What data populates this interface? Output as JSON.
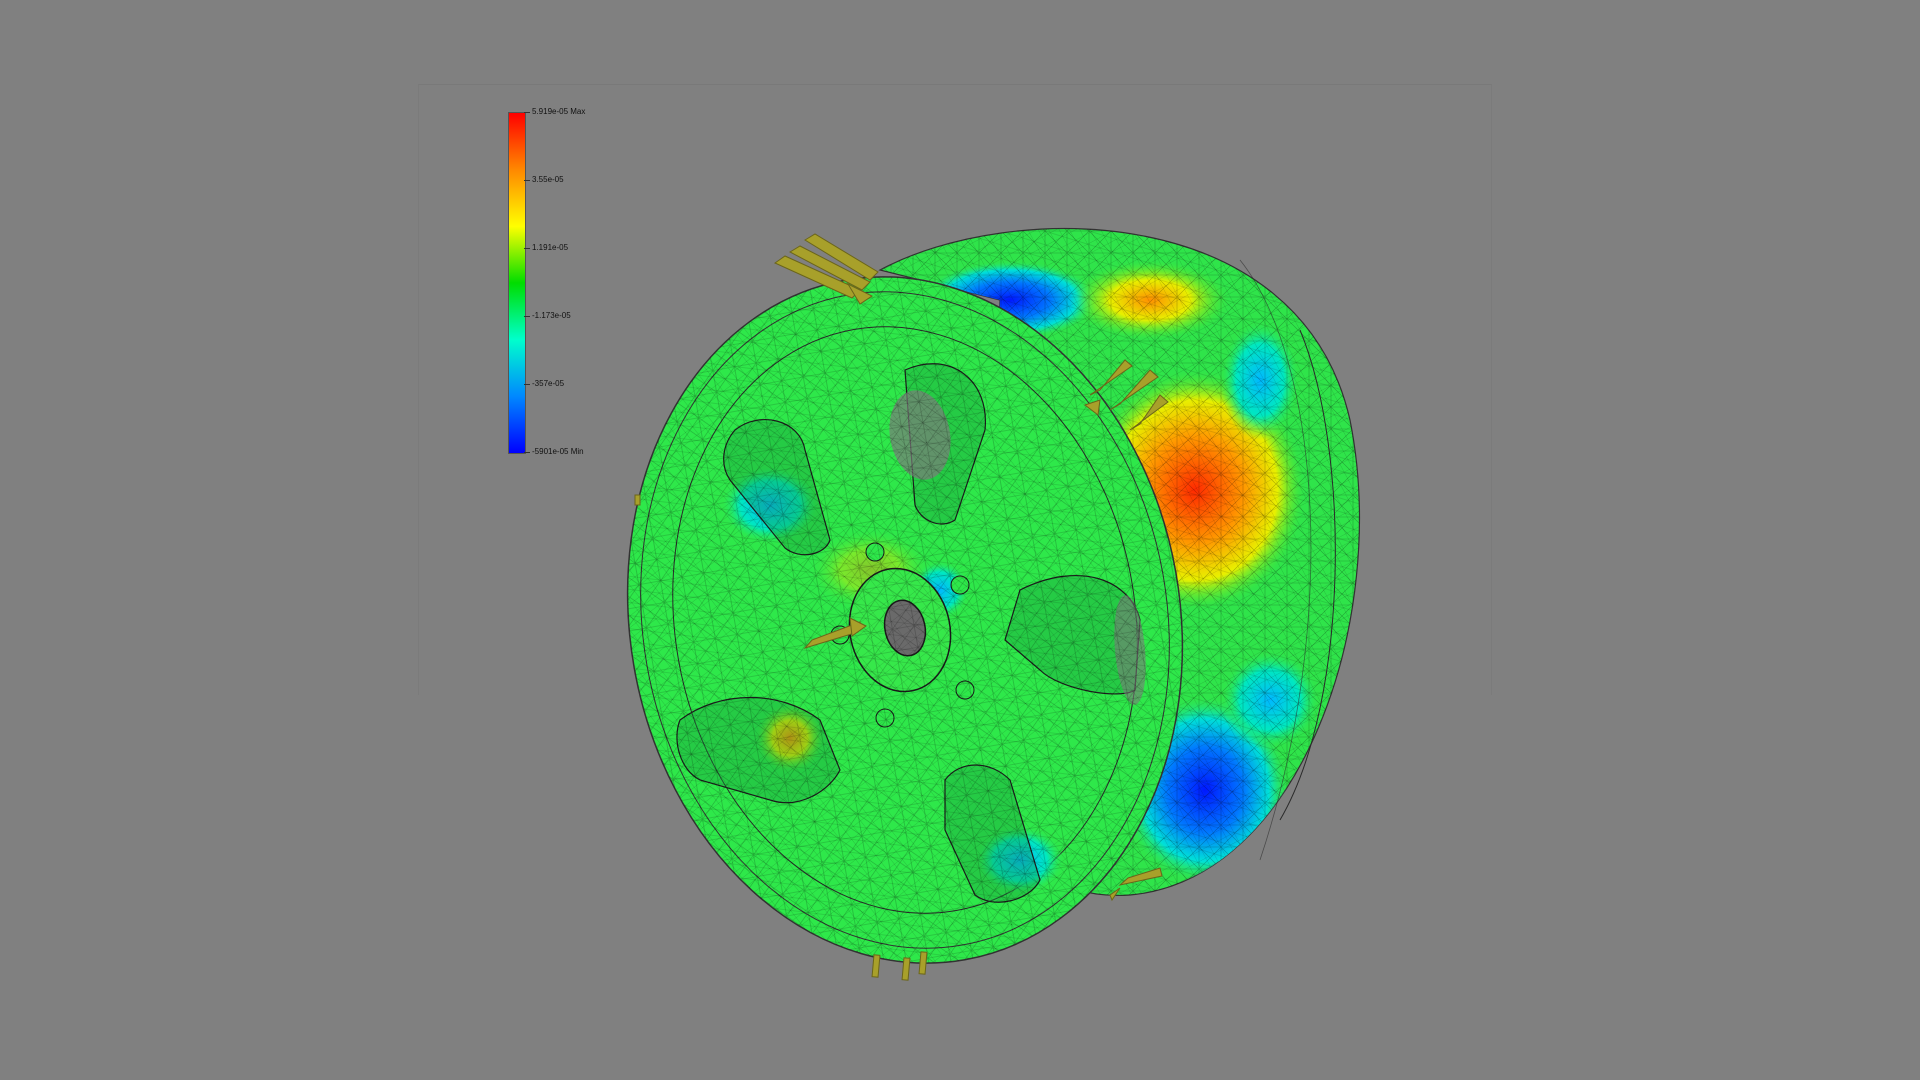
{
  "legend": {
    "gradient_colors": [
      "#ff0000",
      "#ff8800",
      "#ffff00",
      "#00dd00",
      "#00ffcc",
      "#0088ff",
      "#0000ff"
    ],
    "labels": [
      {
        "text": "5.919e-05 Max",
        "level": 1.0
      },
      {
        "text": "3.55e-05",
        "level": 0.8
      },
      {
        "text": "1.191e-05",
        "level": 0.6
      },
      {
        "text": "-1.173e-05",
        "level": 0.4
      },
      {
        "text": "-357e-05",
        "level": 0.2
      },
      {
        "text": "-5901e-05 Min",
        "level": 0.0
      }
    ]
  },
  "model": {
    "name": "wheel-rim",
    "rim_hot_color": "#ff3a00",
    "rim_cold_color": "#0033ff",
    "base_color": "#22e840",
    "load_arrow_color": "#a8a02a"
  }
}
